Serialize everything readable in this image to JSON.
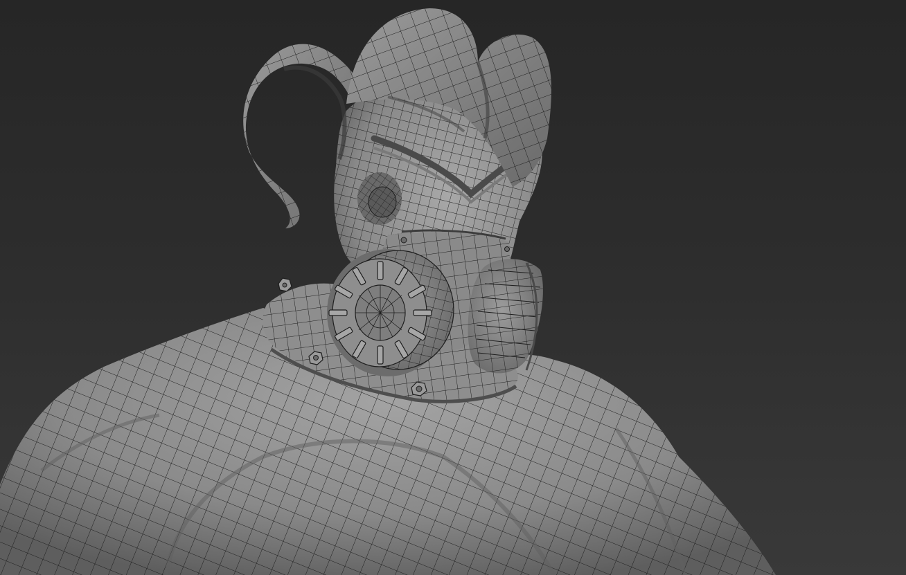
{
  "viewport": {
    "background_top": "#262626",
    "background_bottom": "#3a3a3a"
  },
  "model": {
    "skin_color": "#8c8c8c",
    "wire_color": "#1c1c1c",
    "shadow_color": "#5a5a5a",
    "features": [
      "horn-left",
      "horn-right",
      "head",
      "eye",
      "gas-mask",
      "filter-front",
      "filter-side",
      "neck-collar",
      "bolts",
      "torso"
    ]
  }
}
